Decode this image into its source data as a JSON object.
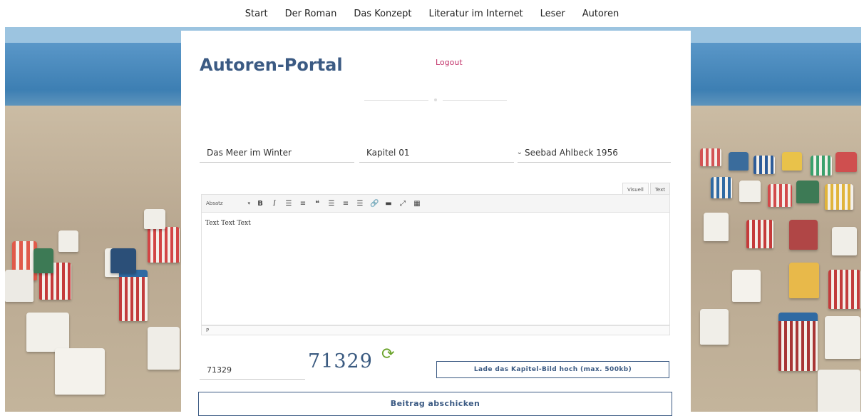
{
  "nav": {
    "items": [
      "Start",
      "Der Roman",
      "Das Konzept",
      "Literatur im Internet",
      "Leser",
      "Autoren"
    ]
  },
  "portal": {
    "title": "Autoren-Portal",
    "logout": "Logout"
  },
  "form": {
    "novel_title": "Das Meer im Winter",
    "chapter_select": "Kapitel 01",
    "chapter_title": "Seebad Ahlbeck 1956"
  },
  "editor": {
    "tabs": [
      "Visuell",
      "Text"
    ],
    "format_select": "Absatz",
    "content": "Text Text Text",
    "status_path": "P"
  },
  "captcha": {
    "image_text": "71329",
    "input_value": "71329"
  },
  "buttons": {
    "upload": "Lade das Kapitel-Bild hoch (max. 500kb)",
    "submit": "Beitrag abschicken"
  },
  "colors": {
    "brand": "#3b5a83",
    "logout": "#c2336a",
    "refresh": "#6aa32a"
  }
}
